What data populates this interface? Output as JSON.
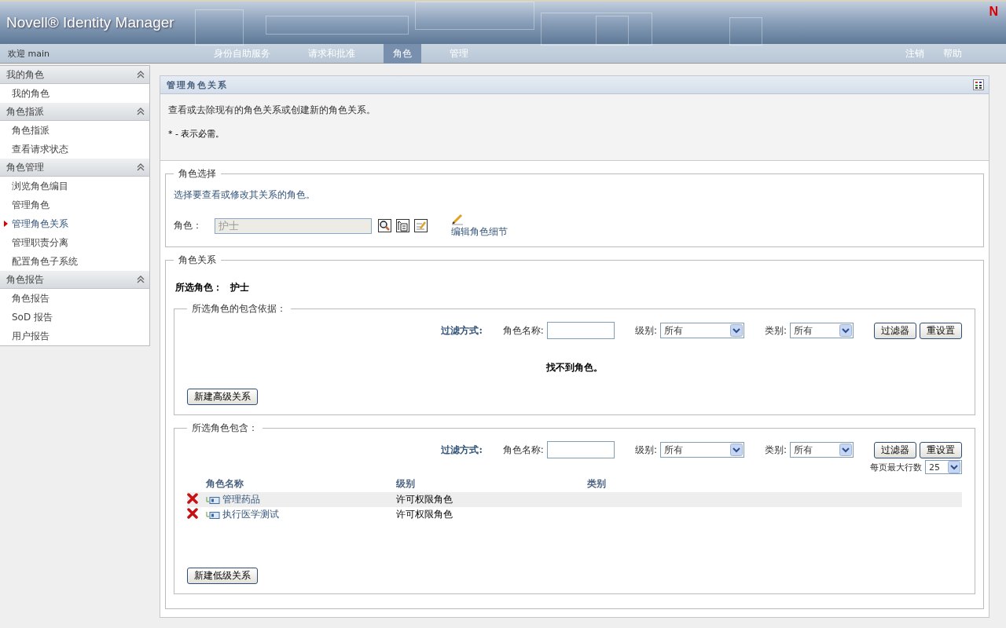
{
  "header": {
    "app_title": "Novell® Identity Manager",
    "logo_mark": "N"
  },
  "nav": {
    "welcome": "欢迎 main",
    "tabs": [
      {
        "label": "身份自助服务",
        "selected": false
      },
      {
        "label": "请求和批准",
        "selected": false
      },
      {
        "label": "角色",
        "selected": true
      },
      {
        "label": "管理",
        "selected": false
      }
    ],
    "links": [
      "注销",
      "帮助"
    ]
  },
  "sidebar": [
    {
      "title": "我的角色",
      "items": [
        {
          "label": "我的角色",
          "selected": false
        }
      ]
    },
    {
      "title": "角色指派",
      "items": [
        {
          "label": "角色指派",
          "selected": false
        },
        {
          "label": "查看请求状态",
          "selected": false
        }
      ]
    },
    {
      "title": "角色管理",
      "items": [
        {
          "label": "浏览角色编目",
          "selected": false
        },
        {
          "label": "管理角色",
          "selected": false
        },
        {
          "label": "管理角色关系",
          "selected": true
        },
        {
          "label": "管理职责分离",
          "selected": false
        },
        {
          "label": "配置角色子系统",
          "selected": false
        }
      ]
    },
    {
      "title": "角色报告",
      "items": [
        {
          "label": "角色报告",
          "selected": false
        },
        {
          "label": "SoD 报告",
          "selected": false
        },
        {
          "label": "用户报告",
          "selected": false
        }
      ]
    }
  ],
  "panel": {
    "title": "管理角色关系",
    "description": "查看或去除现有的角色关系或创建新的角色关系。",
    "required_note": "* - 表示必需。"
  },
  "role_selection": {
    "legend": "角色选择",
    "instruction": "选择要查看或修改其关系的角色。",
    "field_label": "角色：",
    "field_value": "护士",
    "edit_link": "编辑角色细节"
  },
  "relations": {
    "legend": "角色关系",
    "selected_label": "所选角色：",
    "selected_value": "护士",
    "sections": [
      {
        "legend": "所选角色的包含依据：",
        "filter": {
          "title": "过滤方式:",
          "name_label": "角色名称:",
          "level_label": "级别:",
          "level_value": "所有",
          "category_label": "类别:",
          "category_value": "所有",
          "filter_button": "过滤器",
          "reset_button": "重设置"
        },
        "empty_message": "找不到角色。",
        "new_button": "新建高级关系"
      },
      {
        "legend": "所选角色包含：",
        "filter": {
          "title": "过滤方式:",
          "name_label": "角色名称:",
          "level_label": "级别:",
          "level_value": "所有",
          "category_label": "类别:",
          "category_value": "所有",
          "filter_button": "过滤器",
          "reset_button": "重设置"
        },
        "page_size_label": "每页最大行数",
        "page_size_value": "25",
        "table": {
          "columns": [
            "角色名称",
            "级别",
            "类别"
          ],
          "rows": [
            {
              "name": "管理药品",
              "level": "许可权限角色"
            },
            {
              "name": "执行医学测试",
              "level": "许可权限角色"
            }
          ]
        },
        "new_button": "新建低级关系"
      }
    ]
  }
}
